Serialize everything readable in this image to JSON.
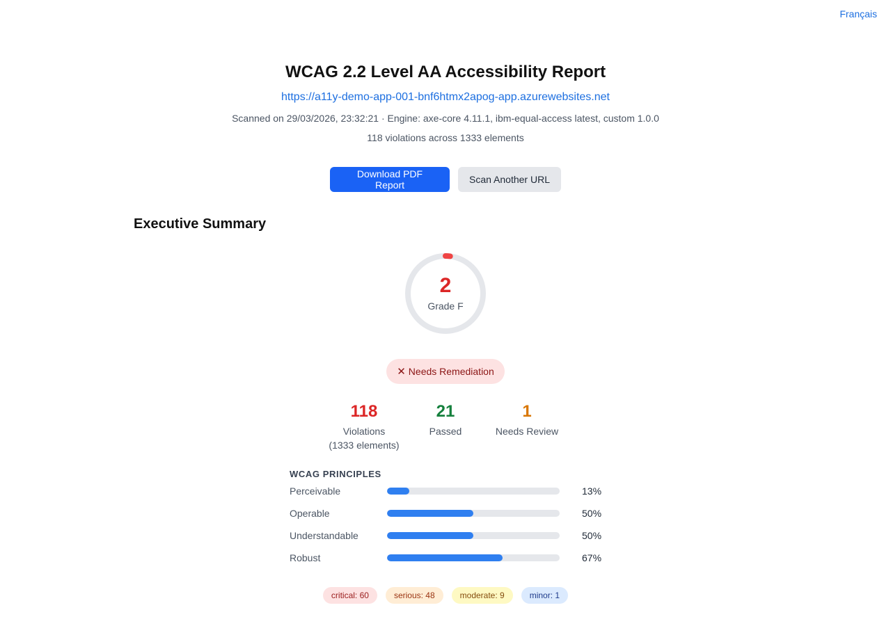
{
  "nav": {
    "language_link": "Français"
  },
  "report": {
    "title": "WCAG 2.2 Level AA Accessibility Report",
    "url": "https://a11y-demo-app-001-bnf6htmx2apog-app.azurewebsites.net",
    "scan_meta": "Scanned on 29/03/2026, 23:32:21 · Engine: axe-core 4.11.1, ibm-equal-access latest, custom 1.0.0",
    "violations_summary": "118 violations across 1333 elements"
  },
  "actions": {
    "download_label": "Download PDF Report",
    "scan_another_label": "Scan Another URL"
  },
  "summary": {
    "heading": "Executive Summary",
    "score": "2",
    "score_value": 2,
    "score_max": 100,
    "grade": "Grade F",
    "status_icon": "x-icon",
    "status": "Needs Remediation",
    "colors": {
      "score": "#dc2626",
      "gauge_track": "#e5e7eb",
      "bar_fill": "#2f7ff0"
    }
  },
  "stats": [
    {
      "value": "118",
      "label": "Violations",
      "sublabel": "(1333 elements)",
      "color": "#dc2626"
    },
    {
      "value": "21",
      "label": "Passed",
      "sublabel": "",
      "color": "#15803d"
    },
    {
      "value": "1",
      "label": "Needs Review",
      "sublabel": "",
      "color": "#d97706"
    }
  ],
  "principles": {
    "heading": "WCAG PRINCIPLES",
    "items": [
      {
        "name": "Perceivable",
        "percent": 13,
        "percent_label": "13%"
      },
      {
        "name": "Operable",
        "percent": 50,
        "percent_label": "50%"
      },
      {
        "name": "Understandable",
        "percent": 50,
        "percent_label": "50%"
      },
      {
        "name": "Robust",
        "percent": 67,
        "percent_label": "67%"
      }
    ]
  },
  "impact": [
    {
      "label": "critical: 60",
      "level": "critical"
    },
    {
      "label": "serious: 48",
      "level": "serious"
    },
    {
      "label": "moderate: 9",
      "level": "moderate"
    },
    {
      "label": "minor: 1",
      "level": "minor"
    }
  ]
}
